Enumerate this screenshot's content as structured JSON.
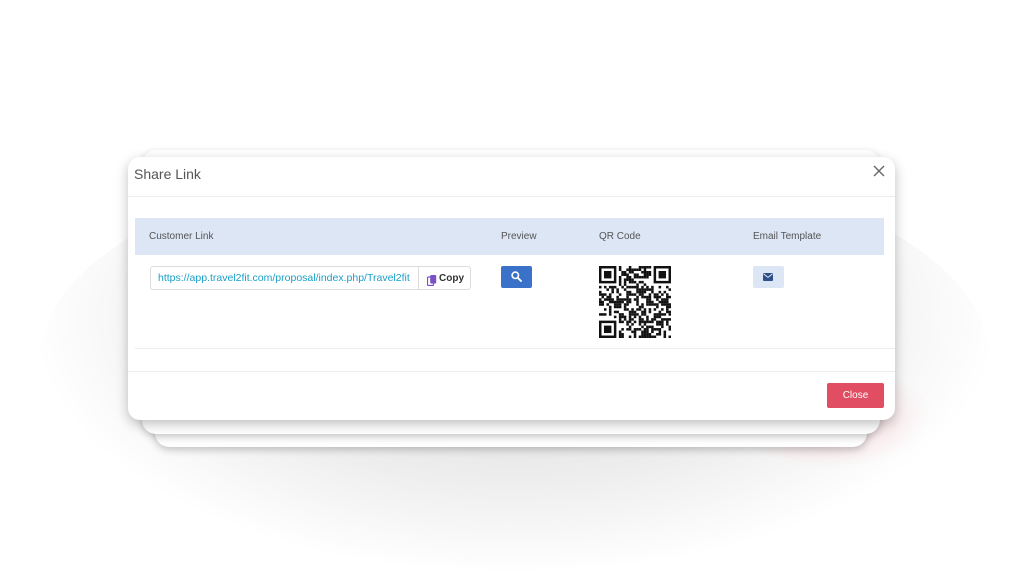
{
  "modal": {
    "title": "Share Link",
    "close_icon": "close-x-icon"
  },
  "table": {
    "headers": [
      "Customer Link",
      "Preview",
      "QR Code",
      "Email Template"
    ],
    "row": {
      "link_value": "https://app.travel2fit.com/proposal/index.php/Travel2fit",
      "copy_label": "Copy",
      "copy_icon": "copy-icon",
      "preview_icon": "search-icon",
      "qr_icon": "qr-code-icon",
      "email_icon": "envelope-icon"
    }
  },
  "footer": {
    "close_label": "Close"
  },
  "colors": {
    "header_bg": "#dce6f5",
    "link_text": "#1aa0c8",
    "preview_button": "#3a72c9",
    "close_button": "#e14d63",
    "copy_icon": "#7b4fc7"
  }
}
